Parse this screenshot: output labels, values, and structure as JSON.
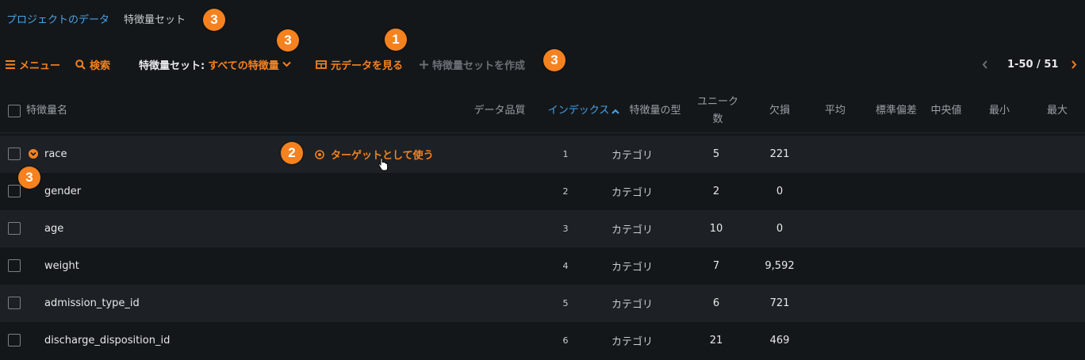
{
  "breadcrumb": {
    "project_data": "プロジェクトのデータ",
    "feature_set": "特徴量セット"
  },
  "toolbar": {
    "menu_label": "メニュー",
    "search_label": "検索",
    "featureset_prefix": "特徴量セット:",
    "featureset_value": "すべての特徴量",
    "view_raw_label": "元データを見る",
    "create_set_label": "特徴量セットを作成",
    "pagination": "1-50 / 51"
  },
  "columns": {
    "name": "特徴量名",
    "quality": "データ品質",
    "index": "インデックス",
    "type": "特徴量の型",
    "unique_line1": "ユニーク",
    "unique_line2": "数",
    "missing": "欠損",
    "mean": "平均",
    "std": "標準偏差",
    "median": "中央値",
    "min": "最小",
    "max": "最大"
  },
  "sort": {
    "column": "インデックス",
    "direction": "ascending"
  },
  "rows": [
    {
      "name": "race",
      "index": "1",
      "type": "カテゴリ",
      "unique": "5",
      "missing": "221",
      "action": "ターゲットとして使う"
    },
    {
      "name": "gender",
      "index": "2",
      "type": "カテゴリ",
      "unique": "2",
      "missing": "0"
    },
    {
      "name": "age",
      "index": "3",
      "type": "カテゴリ",
      "unique": "10",
      "missing": "0"
    },
    {
      "name": "weight",
      "index": "4",
      "type": "カテゴリ",
      "unique": "7",
      "missing": "9,592"
    },
    {
      "name": "admission_type_id",
      "index": "5",
      "type": "カテゴリ",
      "unique": "6",
      "missing": "721"
    },
    {
      "name": "discharge_disposition_id",
      "index": "6",
      "type": "カテゴリ",
      "unique": "21",
      "missing": "469"
    }
  ],
  "callouts": {
    "one": "1",
    "two": "2",
    "three": "3"
  },
  "colors": {
    "accent": "#f5821f",
    "link": "#4aa3e6",
    "background": "#14171a",
    "row_alt": "#1d2125"
  },
  "icons": [
    "menu-icon",
    "search-icon",
    "chevron-down-icon",
    "table-icon",
    "plus-icon",
    "chevron-left-icon",
    "chevron-right-icon",
    "target-icon",
    "expand-icon",
    "sort-up-icon",
    "hand-cursor-icon"
  ]
}
